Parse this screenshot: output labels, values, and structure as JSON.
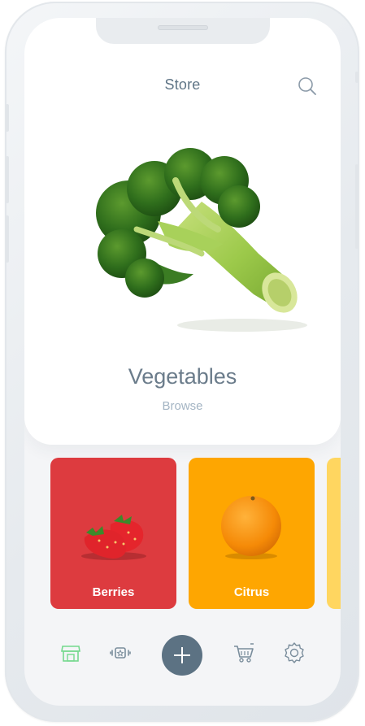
{
  "header": {
    "title": "Store",
    "search_icon": "search-icon"
  },
  "hero": {
    "image": "broccoli-image",
    "category": "Vegetables",
    "action_label": "Browse"
  },
  "categories": [
    {
      "label": "Berries",
      "color": "#dd3b3f",
      "image": "strawberries-image"
    },
    {
      "label": "Citrus",
      "color": "#fea601",
      "image": "orange-image"
    },
    {
      "label": "",
      "color": "#ffd660",
      "image": ""
    }
  ],
  "bottom_nav": {
    "items": [
      "store-icon",
      "fitness-icon",
      "add-icon",
      "cart-icon",
      "settings-icon"
    ],
    "active": "store-icon",
    "active_color": "#75d98e",
    "add_button_color": "#5c7283"
  }
}
